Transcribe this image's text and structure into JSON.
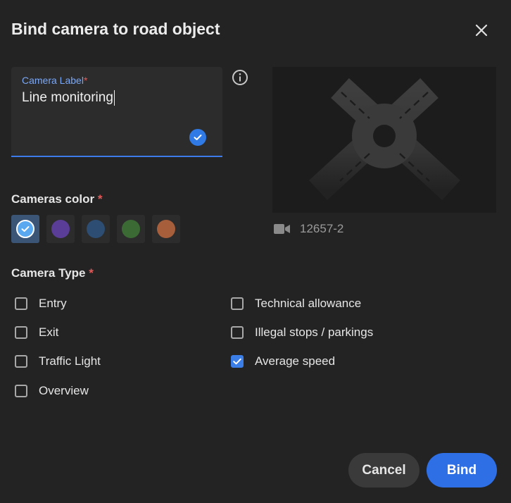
{
  "dialog": {
    "title": "Bind camera to road object"
  },
  "camera_label_field": {
    "label": "Camera Label",
    "required_mark": "*",
    "value": "Line monitoring"
  },
  "preview": {
    "camera_id": "12657-2"
  },
  "colors": {
    "label": "Cameras color",
    "required_mark": "*",
    "options": [
      {
        "color": "#5aa8f0",
        "selected": true
      },
      {
        "color": "#5a3d96",
        "selected": false
      },
      {
        "color": "#2d4d72",
        "selected": false
      },
      {
        "color": "#3b6a35",
        "selected": false
      },
      {
        "color": "#a65e3b",
        "selected": false
      }
    ]
  },
  "camera_type": {
    "label": "Camera Type",
    "required_mark": "*",
    "options": [
      {
        "label": "Entry",
        "checked": false
      },
      {
        "label": "Exit",
        "checked": false
      },
      {
        "label": "Traffic Light",
        "checked": false
      },
      {
        "label": "Overview",
        "checked": false
      },
      {
        "label": "Technical allowance",
        "checked": false
      },
      {
        "label": "Illegal stops / parkings",
        "checked": false
      },
      {
        "label": "Average speed",
        "checked": true
      }
    ]
  },
  "actions": {
    "cancel_label": "Cancel",
    "bind_label": "Bind"
  }
}
